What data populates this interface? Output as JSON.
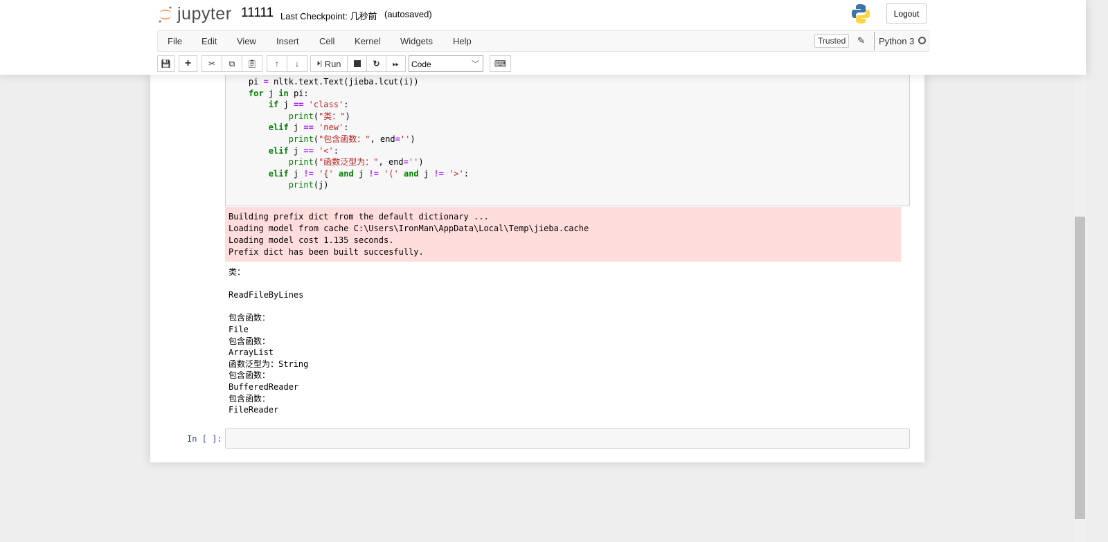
{
  "header": {
    "logo_text": "jupyter",
    "notebook_name": "11111",
    "checkpoint": "Last Checkpoint: 几秒前",
    "autosave": "(autosaved)",
    "logout": "Logout"
  },
  "menu": [
    "File",
    "Edit",
    "View",
    "Insert",
    "Cell",
    "Kernel",
    "Widgets",
    "Help"
  ],
  "kernel": {
    "trusted": "Trusted",
    "name": "Python 3"
  },
  "toolbar": {
    "run": "Run",
    "cell_type": "Code"
  },
  "code_lines": [
    [
      [
        "    pi ",
        ""
      ],
      [
        "=",
        "op"
      ],
      [
        " nltk.text.Text(jieba.lcut(i))",
        ""
      ]
    ],
    [
      [
        "    ",
        ""
      ],
      [
        "for",
        "kw"
      ],
      [
        " j ",
        ""
      ],
      [
        "in",
        "kw"
      ],
      [
        " pi:",
        ""
      ]
    ],
    [
      [
        "        ",
        ""
      ],
      [
        "if",
        "kw"
      ],
      [
        " j ",
        ""
      ],
      [
        "==",
        "op"
      ],
      [
        " ",
        ""
      ],
      [
        "'class'",
        "st"
      ],
      [
        ":",
        ""
      ]
    ],
    [
      [
        "            ",
        ""
      ],
      [
        "print",
        "bi"
      ],
      [
        "(",
        ""
      ],
      [
        "\"类：\"",
        "st"
      ],
      [
        ")",
        ""
      ]
    ],
    [
      [
        "        ",
        ""
      ],
      [
        "elif",
        "kw"
      ],
      [
        " j ",
        ""
      ],
      [
        "==",
        "op"
      ],
      [
        " ",
        ""
      ],
      [
        "'new'",
        "st"
      ],
      [
        ":",
        ""
      ]
    ],
    [
      [
        "            ",
        ""
      ],
      [
        "print",
        "bi"
      ],
      [
        "(",
        ""
      ],
      [
        "\"包含函数：\"",
        "st"
      ],
      [
        ", end",
        ""
      ],
      [
        "=",
        "op"
      ],
      [
        "''",
        "st"
      ],
      [
        ")",
        ""
      ]
    ],
    [
      [
        "        ",
        ""
      ],
      [
        "elif",
        "kw"
      ],
      [
        " j ",
        ""
      ],
      [
        "==",
        "op"
      ],
      [
        " ",
        ""
      ],
      [
        "'<'",
        "st"
      ],
      [
        ":",
        ""
      ]
    ],
    [
      [
        "            ",
        ""
      ],
      [
        "print",
        "bi"
      ],
      [
        "(",
        ""
      ],
      [
        "\"函数泛型为：\"",
        "st"
      ],
      [
        ", end",
        ""
      ],
      [
        "=",
        "op"
      ],
      [
        "''",
        "st"
      ],
      [
        ")",
        ""
      ]
    ],
    [
      [
        "        ",
        ""
      ],
      [
        "elif",
        "kw"
      ],
      [
        " j ",
        ""
      ],
      [
        "!=",
        "op"
      ],
      [
        " ",
        ""
      ],
      [
        "'{'",
        "st"
      ],
      [
        " ",
        ""
      ],
      [
        "and",
        "kw"
      ],
      [
        " j ",
        ""
      ],
      [
        "!=",
        "op"
      ],
      [
        " ",
        ""
      ],
      [
        "'('",
        "st"
      ],
      [
        " ",
        ""
      ],
      [
        "and",
        "kw"
      ],
      [
        " j ",
        ""
      ],
      [
        "!=",
        "op"
      ],
      [
        " ",
        ""
      ],
      [
        "'>'",
        "st"
      ],
      [
        ":",
        ""
      ]
    ],
    [
      [
        "            ",
        ""
      ],
      [
        "print",
        "bi"
      ],
      [
        "(j)",
        ""
      ]
    ]
  ],
  "stderr": [
    "Building prefix dict from the default dictionary ...",
    "Loading model from cache C:\\Users\\IronMan\\AppData\\Local\\Temp\\jieba.cache",
    "Loading model cost 1.135 seconds.",
    "Prefix dict has been built succesfully."
  ],
  "stdout": [
    "类：",
    "",
    "ReadFileByLines",
    "",
    "包含函数：",
    "File",
    "包含函数：",
    "ArrayList",
    "函数泛型为：String",
    "包含函数：",
    "BufferedReader",
    "包含函数：",
    "FileReader"
  ],
  "empty_cell_prompt": "In [ ]:"
}
